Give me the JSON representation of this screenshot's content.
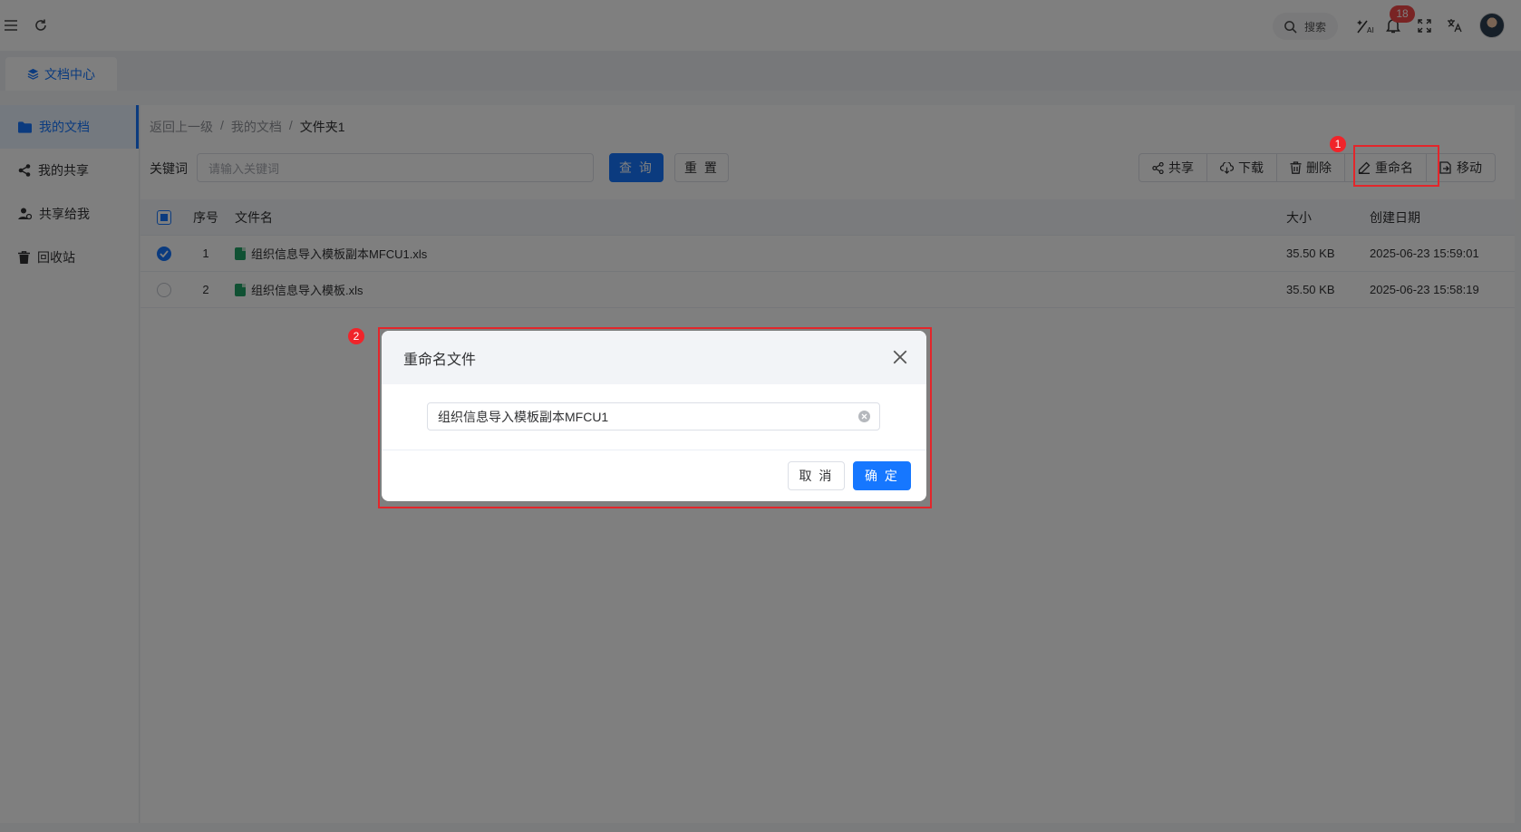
{
  "topbar": {
    "search_label": "搜索",
    "notification_count": "18"
  },
  "tabs": [
    {
      "label": "文档中心"
    }
  ],
  "sidebar": {
    "items": [
      {
        "label": "我的文档",
        "icon": "folder-icon",
        "active": true
      },
      {
        "label": "我的共享",
        "icon": "share-icon"
      },
      {
        "label": "共享给我",
        "icon": "user-share-icon"
      },
      {
        "label": "回收站",
        "icon": "trash-icon"
      }
    ]
  },
  "breadcrumb": {
    "back": "返回上一级",
    "sep": "/",
    "level1": "我的文档",
    "current": "文件夹1"
  },
  "filter": {
    "keyword_label": "关键词",
    "keyword_placeholder": "请输入关键词",
    "query_label": "查 询",
    "reset_label": "重 置"
  },
  "actions": {
    "share": "共享",
    "download": "下载",
    "delete": "删除",
    "rename": "重命名",
    "move": "移动"
  },
  "table": {
    "headers": {
      "index": "序号",
      "name": "文件名",
      "size": "大小",
      "date": "创建日期"
    },
    "rows": [
      {
        "index": "1",
        "name": "组织信息导入模板副本MFCU1.xls",
        "size": "35.50 KB",
        "date": "2025-06-23 15:59:01",
        "checked": true
      },
      {
        "index": "2",
        "name": "组织信息导入模板.xls",
        "size": "35.50 KB",
        "date": "2025-06-23 15:58:19",
        "checked": false
      }
    ]
  },
  "dialog": {
    "title": "重命名文件",
    "input_value": "组织信息导入模板副本MFCU1",
    "cancel_label": "取 消",
    "confirm_label": "确 定"
  },
  "annotations": {
    "marker1": "1",
    "marker2": "2"
  },
  "colors": {
    "primary": "#1677ff",
    "annotation_red": "#e3262b",
    "excel_green": "#21a366"
  }
}
